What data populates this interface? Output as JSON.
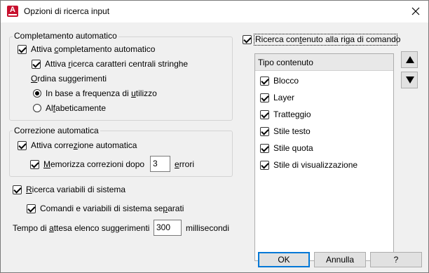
{
  "window": {
    "title": "Opzioni di ricerca input",
    "app_icon_letter": "A"
  },
  "autocomplete": {
    "legend": "Completamento automatico",
    "enable": {
      "pre": "Attiva ",
      "u": "c",
      "post": "ompletamento automatico",
      "checked": true
    },
    "mid_search": {
      "pre": "Attiva ",
      "u": "r",
      "post": "icerca caratteri centrali stringhe",
      "checked": true
    },
    "sort_label": {
      "pre": "",
      "u": "O",
      "post": "rdina suggerimenti"
    },
    "by_frequency": {
      "pre": "In base a frequenza di ",
      "u": "u",
      "post": "tilizzo",
      "checked": true
    },
    "alphabetical": {
      "pre": "Al",
      "u": "f",
      "post": "abeticamente",
      "checked": false
    }
  },
  "autocorrect": {
    "legend": "Correzione automatica",
    "enable": {
      "pre": "Attiva corre",
      "u": "z",
      "post": "ione automatica",
      "checked": true
    },
    "remember": {
      "pre": "",
      "u": "M",
      "post": "emorizza correzioni dopo",
      "checked": true
    },
    "remember_value": "3",
    "remember_suffix": {
      "pre": "",
      "u": "e",
      "post": "rrori"
    }
  },
  "sysvar": {
    "search": {
      "pre": "",
      "u": "R",
      "post": "icerca variabili di sistema",
      "checked": true
    },
    "commands": {
      "pre": "Comandi e variabili di sistema se",
      "u": "p",
      "post": "arati",
      "checked": true
    }
  },
  "delay": {
    "label": {
      "pre": "Tempo di ",
      "u": "a",
      "post": "ttesa elenco suggerimenti"
    },
    "value": "300",
    "unit": "millisecondi"
  },
  "content_search": {
    "enable": {
      "pre": "Ricerca con",
      "u": "t",
      "post": "enuto alla riga di comando",
      "checked": true
    },
    "header": "Tipo contenuto",
    "items": [
      {
        "label": "Blocco",
        "checked": true
      },
      {
        "label": "Layer",
        "checked": true
      },
      {
        "label": "Tratteggio",
        "checked": true
      },
      {
        "label": "Stile testo",
        "checked": true
      },
      {
        "label": "Stile quota",
        "checked": true
      },
      {
        "label": "Stile di visualizzazione",
        "checked": true
      }
    ]
  },
  "buttons": {
    "ok": "OK",
    "cancel": "Annulla",
    "help": "?"
  },
  "colors": {
    "accent": "#0078d7",
    "app_red": "#c8102e"
  }
}
